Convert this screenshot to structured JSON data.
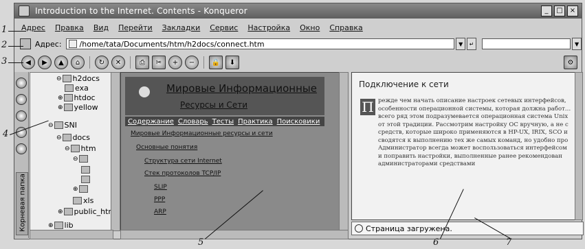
{
  "window": {
    "title": "Introduction to the Internet. Contents - Konqueror"
  },
  "menu": [
    "Адрес",
    "Правка",
    "Вид",
    "Перейти",
    "Закладки",
    "Сервис",
    "Настройка",
    "Окно",
    "Справка"
  ],
  "location": {
    "label": "Адрес:",
    "value": "/home/tata/Documents/htm/h2docs/connect.htm"
  },
  "tree": {
    "items": [
      "h2docs",
      "exa",
      "htdoc",
      "yellow",
      "SNI",
      "docs",
      "htm",
      "xls",
      "public_htm",
      "lib"
    ],
    "sidebar_tab": "Корневая папка"
  },
  "left_page": {
    "heading1": "Мировые Информационные",
    "heading2": "Ресурсы и Сети",
    "nav": [
      "Содержание",
      "Словарь",
      "Тесты",
      "Практика",
      "Поисковики"
    ],
    "breadcrumb": "Мировые Информационные ресурсы и сети",
    "toc": [
      "Основные понятия",
      "Структура сети Internet",
      "Стек протоколов TCP/IP",
      "SLIP",
      "PPP",
      "ARP"
    ]
  },
  "right_page": {
    "heading": "Подключение к сети",
    "dropcap": "П",
    "text": "режде чем начать описание настроек сетевых интерфейсов, особенности операционной системы, которая должна работ… всего ряд этом подразумевается операционная система Unix от этой традиции. Рассмотрим настройку ОС вручную, а не с средств, которые широко применяются в HP-UX, IRIX, SCO и сводятся к выполнению тех же самых команд, но удобно про Администратор всегда может воспользоваться интерфейсом и поправить настройки, выполненные ранее рекомендован администраторами средствами"
  },
  "status": {
    "text": "Страница загружена."
  },
  "callouts": [
    "1",
    "2",
    "3",
    "4",
    "5",
    "6",
    "7"
  ]
}
